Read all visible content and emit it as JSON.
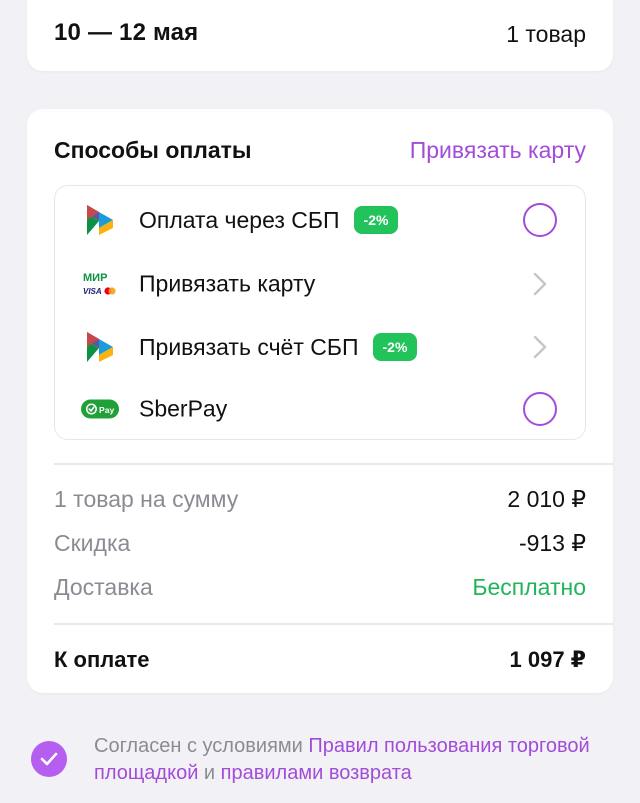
{
  "delivery": {
    "dates": "10 — 12 мая",
    "items_count": "1 товар"
  },
  "payment": {
    "title": "Способы оплаты",
    "bind_card_link": "Привязать карту",
    "methods": [
      {
        "label": "Оплата через СБП",
        "badge": "-2%",
        "icon": "sbp-icon",
        "control": "radio"
      },
      {
        "label": "Привязать карту",
        "badge": "",
        "icon": "mir-visa-mastercard-icon",
        "control": "chevron"
      },
      {
        "label": "Привязать счёт СБП",
        "badge": "-2%",
        "icon": "sbp-icon",
        "control": "chevron"
      },
      {
        "label": "SberPay",
        "badge": "",
        "icon": "sberpay-icon",
        "control": "radio"
      }
    ]
  },
  "summary": {
    "items_label": "1 товар на сумму",
    "items_value": "2 010 ₽",
    "discount_label": "Скидка",
    "discount_value": "-913 ₽",
    "delivery_label": "Доставка",
    "delivery_value": "Бесплатно",
    "total_label": "К оплате",
    "total_value": "1 097 ₽"
  },
  "agreement": {
    "prefix": "Согласен с условиями ",
    "link1": "Правил пользования торговой площадкой",
    "middle": " и ",
    "link2": "правилами возврата",
    "checked": true
  },
  "colors": {
    "accent": "#a24cd8",
    "badge_green": "#22c35b",
    "free_green": "#22b45a",
    "checkbox": "#b65ef0"
  }
}
